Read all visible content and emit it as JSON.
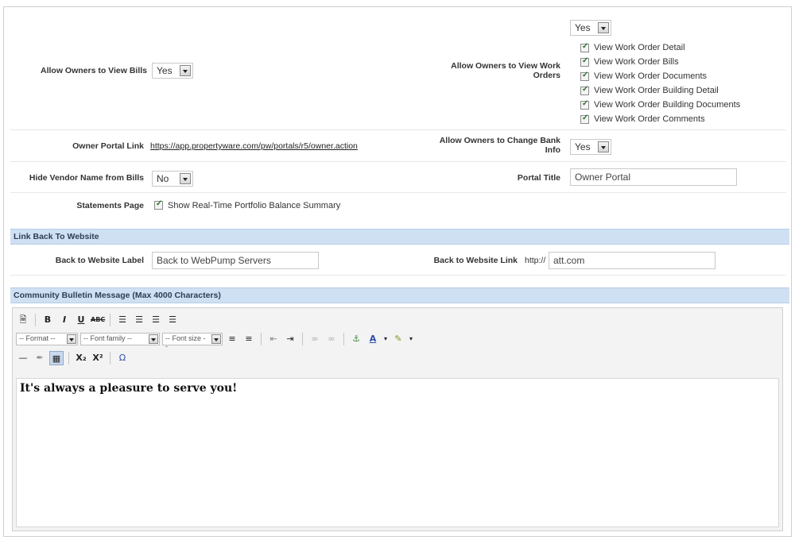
{
  "bills": {
    "label": "Allow Owners to View Bills",
    "value": "Yes"
  },
  "work_orders": {
    "label_line1": "Allow Owners to View Work",
    "label_line2": "Orders",
    "value": "Yes",
    "options": [
      "View Work Order Detail",
      "View Work Order Bills",
      "View Work Order Documents",
      "View Work Order Building Detail",
      "View Work Order Building Documents",
      "View Work Order Comments"
    ]
  },
  "portal_link": {
    "label": "Owner Portal Link",
    "url": "https://app.propertyware.com/pw/portals/r5/owner.action"
  },
  "bank_info": {
    "label_line1": "Allow Owners to Change Bank",
    "label_line2": "Info",
    "value": "Yes"
  },
  "hide_vendor": {
    "label": "Hide Vendor Name from Bills",
    "value": "No"
  },
  "portal_title": {
    "label": "Portal Title",
    "value": "Owner Portal"
  },
  "statements": {
    "label": "Statements Page",
    "option": "Show Real-Time Portfolio Balance Summary"
  },
  "link_back": {
    "section_title": "Link Back To Website",
    "label_field": {
      "label": "Back to Website Label",
      "value": "Back to WebPump Servers"
    },
    "link_field": {
      "label": "Back to Website Link",
      "prefix": "http://",
      "value": "att.com"
    }
  },
  "bulletin": {
    "section_title": "Community Bulletin Message (Max 4000 Characters)",
    "toolbar": {
      "format": "-- Format --",
      "font_family": "-- Font family --",
      "font_size": "-- Font size --"
    },
    "content": "It's always a pleasure to serve you!"
  }
}
